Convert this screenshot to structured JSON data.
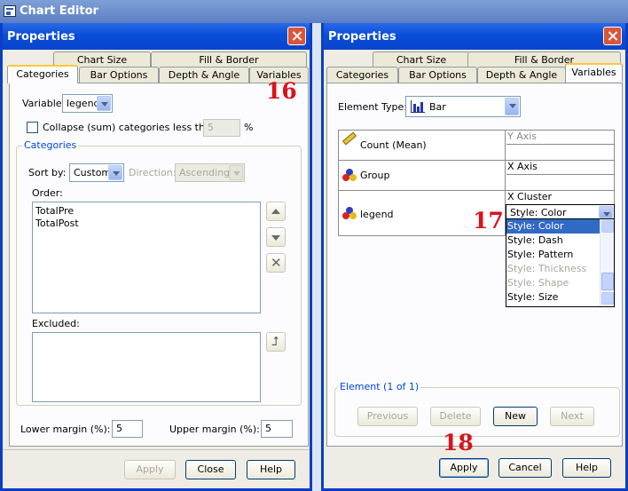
{
  "app": {
    "title": "Chart Editor"
  },
  "left_dialog": {
    "title": "Properties",
    "tabs_back": [
      "Chart Size",
      "Fill & Border"
    ],
    "tabs_front": [
      "Categories",
      "Bar Options",
      "Depth & Angle",
      "Variables"
    ],
    "active_tab": "Categories",
    "variable_label": "Variable:",
    "variable_value": "legend",
    "collapse_label": "Collapse (sum) categories less than:",
    "collapse_value": "5",
    "percent": "%",
    "group_title": "Categories",
    "sort_by_label": "Sort by:",
    "sort_by_value": "Custom",
    "direction_label": "Direction:",
    "direction_value": "Ascending",
    "order_label": "Order:",
    "order_items": [
      "TotalPre",
      "TotalPost"
    ],
    "excluded_label": "Excluded:",
    "lower_margin_label": "Lower margin (%):",
    "lower_margin_value": "5",
    "upper_margin_label": "Upper margin (%):",
    "upper_margin_value": "5",
    "buttons": {
      "apply": "Apply",
      "close": "Close",
      "help": "Help"
    },
    "annotation": "16"
  },
  "right_dialog": {
    "title": "Properties",
    "tabs_back": [
      "Chart Size",
      "Fill & Border"
    ],
    "tabs_front": [
      "Categories",
      "Bar Options",
      "Depth & Angle",
      "Variables"
    ],
    "active_tab": "Variables",
    "element_type_label": "Element Type:",
    "element_type_value": "Bar",
    "variables": [
      {
        "name": "Count (Mean)",
        "icon": "ruler-icon",
        "slot_top": "Y Axis",
        "slot_bottom": ""
      },
      {
        "name": "Group",
        "icon": "nominal-variable-icon",
        "slot_top": "X Axis",
        "slot_bottom": ""
      },
      {
        "name": "legend",
        "icon": "nominal-variable-icon",
        "slot_top": "X Cluster",
        "slot_bottom": "Style: Color"
      }
    ],
    "style_options": [
      {
        "label": "Style: Color",
        "state": "selected"
      },
      {
        "label": "Style: Dash",
        "state": "enabled"
      },
      {
        "label": "Style: Pattern",
        "state": "enabled"
      },
      {
        "label": "Style: Thickness",
        "state": "disabled"
      },
      {
        "label": "Style: Shape",
        "state": "disabled"
      },
      {
        "label": "Style: Size",
        "state": "enabled"
      }
    ],
    "element_group_title": "Element (1 of 1)",
    "element_buttons": {
      "previous": "Previous",
      "delete": "Delete",
      "new": "New",
      "next": "Next"
    },
    "buttons": {
      "apply": "Apply",
      "cancel": "Cancel",
      "help": "Help"
    },
    "annotation_dropdown": "17",
    "annotation_apply": "18"
  },
  "colors": {
    "title_bar": "#0a4ed8",
    "annotation": "#d8141a",
    "selection": "#316ac5"
  }
}
